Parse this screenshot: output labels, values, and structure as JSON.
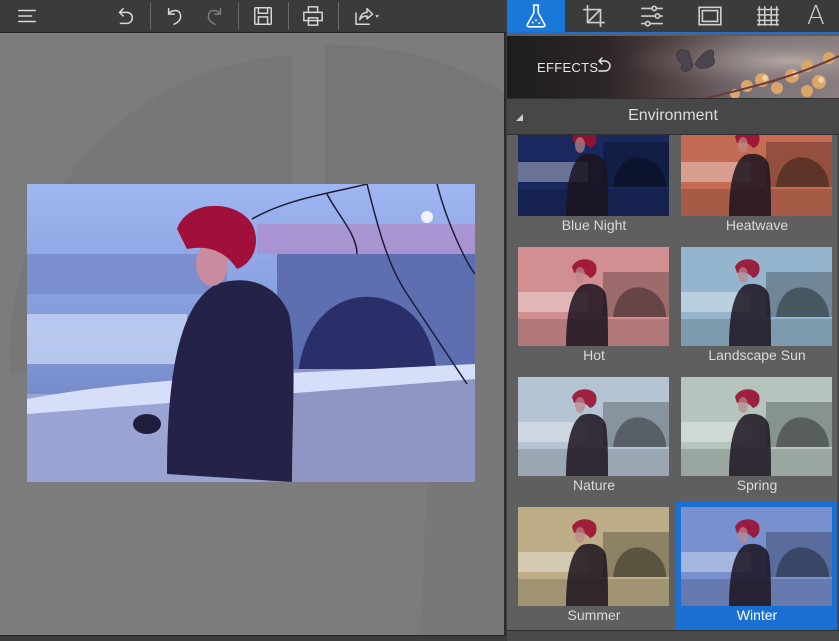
{
  "toolbar": {
    "menu_icon": "hamburger-menu-icon",
    "buttons": [
      {
        "name": "reset-all",
        "icon": "reset-arrow-icon"
      },
      {
        "name": "undo",
        "icon": "undo-icon"
      },
      {
        "name": "redo",
        "icon": "redo-icon",
        "disabled": true
      },
      {
        "name": "save",
        "icon": "save-icon"
      },
      {
        "name": "print",
        "icon": "print-icon"
      },
      {
        "name": "share",
        "icon": "share-icon",
        "has_dropdown": true
      }
    ]
  },
  "panel": {
    "tabs": [
      {
        "name": "effects",
        "icon": "flask-icon",
        "active": true
      },
      {
        "name": "crop",
        "icon": "crop-icon",
        "active": false
      },
      {
        "name": "adjustments",
        "icon": "sliders-icon",
        "active": false
      },
      {
        "name": "frames",
        "icon": "frame-icon",
        "active": false
      },
      {
        "name": "textures",
        "icon": "texture-icon",
        "active": false
      },
      {
        "name": "text",
        "icon": "text-icon",
        "label": "A",
        "active": false
      }
    ],
    "banner": {
      "title": "EFFECTS",
      "reset_icon": "reset-arrow-icon"
    },
    "category": {
      "title": "Environment",
      "expanded": true
    },
    "effects": [
      {
        "label": "Blue Night",
        "tint": "#1d2e6b",
        "selected": false
      },
      {
        "label": "Heatwave",
        "tint": "#e07a5f",
        "selected": false
      },
      {
        "label": "Hot",
        "tint": "#f0a3a6",
        "selected": false
      },
      {
        "label": "Landscape Sun",
        "tint": "#a9cfea",
        "selected": false
      },
      {
        "label": "Nature",
        "tint": "#cfe0f0",
        "selected": false
      },
      {
        "label": "Spring",
        "tint": "#cfe0d6",
        "selected": false
      },
      {
        "label": "Summer",
        "tint": "#d8c79a",
        "selected": false
      },
      {
        "label": "Winter",
        "tint": "#8aa4ec",
        "selected": true
      }
    ]
  },
  "colors": {
    "accent": "#1a78d8",
    "canvas_bg": "#7c7c7c",
    "panel_bg": "#5f5f5f",
    "toolbar_bg": "#3b3b3b"
  }
}
